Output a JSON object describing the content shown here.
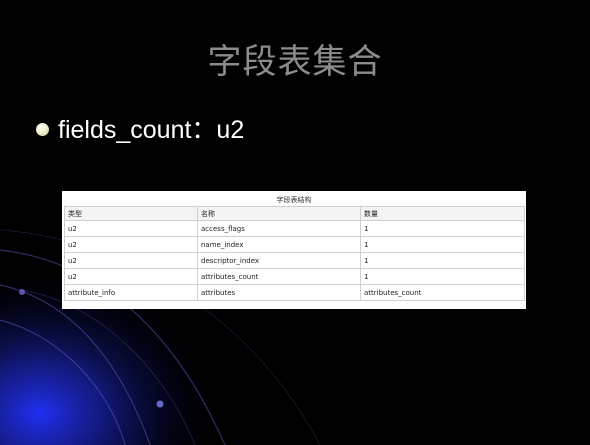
{
  "slide": {
    "title": "字段表集合",
    "bullet": "fields_count：u2"
  },
  "table": {
    "caption": "字段表结构",
    "headers": [
      "类型",
      "名称",
      "数量"
    ],
    "rows": [
      [
        "u2",
        "access_flags",
        "1"
      ],
      [
        "u2",
        "name_index",
        "1"
      ],
      [
        "u2",
        "descriptor_index",
        "1"
      ],
      [
        "u2",
        "attributes_count",
        "1"
      ],
      [
        "attribute_info",
        "attributes",
        "attributes_count"
      ]
    ]
  },
  "colors": {
    "background": "#000000",
    "title": "#8c8c8c",
    "accent_blue": "#1a2bd6"
  }
}
